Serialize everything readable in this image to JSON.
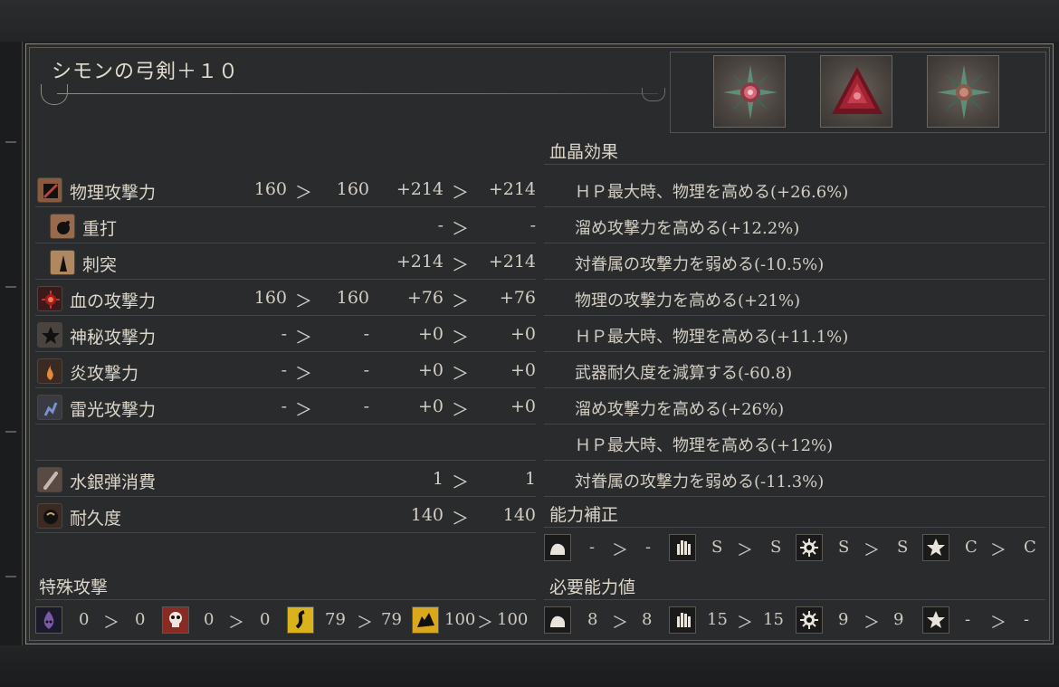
{
  "weapon": {
    "name": "シモンの弓剣＋１０"
  },
  "blood_gem_heading": "血晶効果",
  "stats": [
    {
      "label": "物理攻撃力",
      "icon": "physical-attack-icon",
      "a": "160",
      "a_arrow": "＞",
      "b": "160",
      "c": "+214",
      "c_arrow": "＞",
      "d": "+214"
    },
    {
      "label": "重打",
      "icon": "blunt-icon",
      "a": "",
      "a_arrow": "",
      "b": "",
      "c": "-",
      "c_arrow": "＞",
      "d": "-"
    },
    {
      "label": "刺突",
      "icon": "thrust-icon",
      "a": "",
      "a_arrow": "",
      "b": "",
      "c": "+214",
      "c_arrow": "＞",
      "d": "+214"
    },
    {
      "label": "血の攻撃力",
      "icon": "blood-attack-icon",
      "a": "160",
      "a_arrow": "＞",
      "b": "160",
      "c": "+76",
      "c_arrow": "＞",
      "d": "+76"
    },
    {
      "label": "神秘攻撃力",
      "icon": "arcane-attack-icon",
      "a": "-",
      "a_arrow": "＞",
      "b": "-",
      "c": "+0",
      "c_arrow": "＞",
      "d": "+0"
    },
    {
      "label": "炎攻撃力",
      "icon": "fire-attack-icon",
      "a": "-",
      "a_arrow": "＞",
      "b": "-",
      "c": "+0",
      "c_arrow": "＞",
      "d": "+0"
    },
    {
      "label": "雷光攻撃力",
      "icon": "bolt-attack-icon",
      "a": "-",
      "a_arrow": "＞",
      "b": "-",
      "c": "+0",
      "c_arrow": "＞",
      "d": "+0"
    },
    {
      "label": "",
      "icon": "",
      "a": "",
      "a_arrow": "",
      "b": "",
      "c": "",
      "c_arrow": "",
      "d": ""
    },
    {
      "label": "水銀弾消費",
      "icon": "quicksilver-bullet-icon",
      "a": "",
      "a_arrow": "",
      "b": "",
      "c": "1",
      "c_arrow": "＞",
      "d": "1"
    },
    {
      "label": "耐久度",
      "icon": "durability-icon",
      "a": "",
      "a_arrow": "",
      "b": "",
      "c": "140",
      "c_arrow": "＞",
      "d": "140"
    }
  ],
  "effects": [
    "ＨＰ最大時、物理を高める(+26.6%)",
    "溜め攻撃力を高める(+12.2%)",
    "対眷属の攻撃力を弱める(-10.5%)",
    "物理の攻撃力を高める(+21%)",
    "ＨＰ最大時、物理を高める(+11.1%)",
    "武器耐久度を減算する(-60.8)",
    "溜め攻撃力を高める(+26%)",
    "ＨＰ最大時、物理を高める(+12%)",
    "対眷属の攻撃力を弱める(-11.3%)"
  ],
  "scaling": {
    "heading": "能力補正",
    "items": [
      {
        "icon": "strength-icon",
        "a": "-",
        "arrow": "＞",
        "b": "-"
      },
      {
        "icon": "skill-icon",
        "a": "S",
        "arrow": "＞",
        "b": "S"
      },
      {
        "icon": "bloodtinge-icon",
        "a": "S",
        "arrow": "＞",
        "b": "S"
      },
      {
        "icon": "arcane-icon",
        "a": "C",
        "arrow": "＞",
        "b": "C"
      }
    ]
  },
  "special": {
    "heading": "特殊攻撃",
    "items": [
      {
        "icon": "slow-poison-icon",
        "a": "0",
        "arrow": "＞",
        "b": "0"
      },
      {
        "icon": "rapid-poison-icon",
        "a": "0",
        "arrow": "＞",
        "b": "0"
      },
      {
        "icon": "serrated-icon",
        "a": "79",
        "arrow": "＞",
        "b": "79"
      },
      {
        "icon": "righteous-icon",
        "a": "100",
        "arrow": "＞",
        "b": "100"
      }
    ]
  },
  "requirements": {
    "heading": "必要能力値",
    "items": [
      {
        "icon": "strength-icon",
        "a": "8",
        "arrow": "＞",
        "b": "8"
      },
      {
        "icon": "skill-icon",
        "a": "15",
        "arrow": "＞",
        "b": "15"
      },
      {
        "icon": "bloodtinge-icon",
        "a": "9",
        "arrow": "＞",
        "b": "9"
      },
      {
        "icon": "arcane-icon",
        "a": "-",
        "arrow": "＞",
        "b": "-"
      }
    ]
  },
  "colors": {
    "background": "#2a2b2d",
    "text": "#d3cec4",
    "divider": "#45464a",
    "gem_red": "#b02a3a",
    "gem_green": "#6fa58a",
    "serrated_yellow": "#d9b21c"
  }
}
